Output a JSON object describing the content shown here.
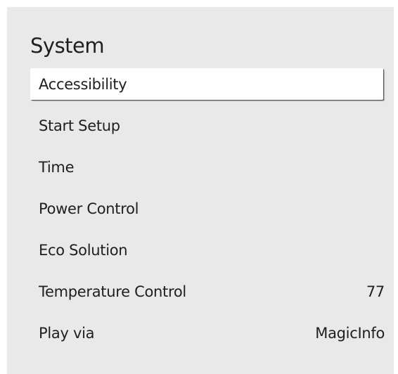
{
  "menu": {
    "title": "System",
    "items": [
      {
        "label": "Accessibility",
        "value": ""
      },
      {
        "label": "Start Setup",
        "value": ""
      },
      {
        "label": "Time",
        "value": ""
      },
      {
        "label": "Power Control",
        "value": ""
      },
      {
        "label": "Eco Solution",
        "value": ""
      },
      {
        "label": "Temperature Control",
        "value": "77"
      },
      {
        "label": "Play via",
        "value": "MagicInfo"
      }
    ]
  },
  "colors": {
    "panel_background": "#e9e9e9",
    "text": "#1f1f1f",
    "selected_background": "#ffffff"
  }
}
